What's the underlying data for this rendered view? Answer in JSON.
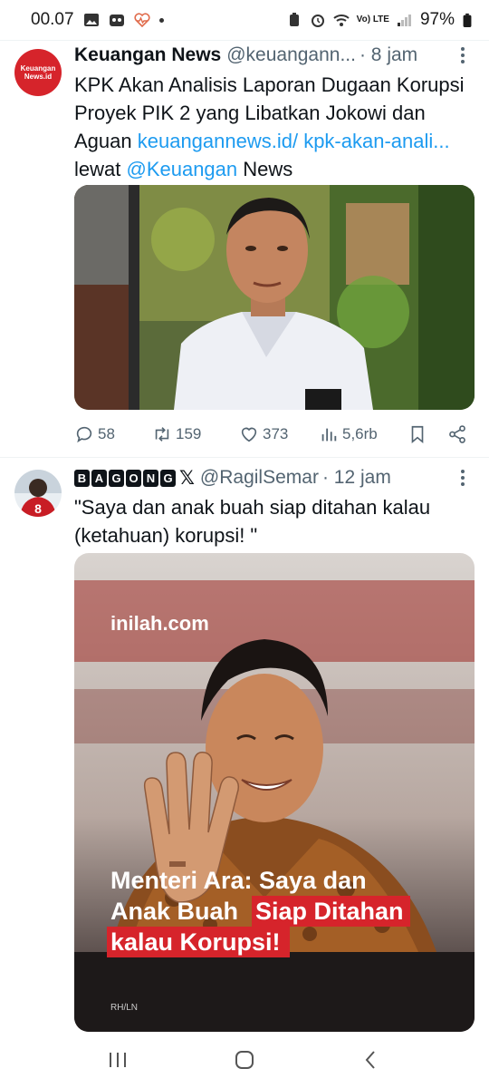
{
  "status_bar": {
    "time": "00.07",
    "battery": "97%",
    "network": "Vo) LTE"
  },
  "tweets": [
    {
      "name": "Keuangan News",
      "handle": "@keuangann...",
      "time": "· 8 jam",
      "avatar_text": "Keuangan News.id",
      "text_plain": "KPK Akan Analisis Laporan Dugaan Korupsi Proyek PIK 2 yang Libatkan Jokowi dan Aguan ",
      "link": "keuangannews.id/ kpk-akan-anali...",
      "text_mid": " lewat ",
      "mention": "@Keuangan",
      "text_end": " News",
      "stats": {
        "replies": "58",
        "retweets": "159",
        "likes": "373",
        "views": "5,6rb"
      }
    },
    {
      "badges": [
        "B",
        "A",
        "G",
        "O",
        "N",
        "G"
      ],
      "x_mark": "𝕏",
      "handle": "@RagilSemar",
      "time": "· 12 jam",
      "avatar_number": "8",
      "text": "\"Saya dan anak buah siap ditahan kalau (ketahuan) korupsi! \"",
      "image": {
        "brand": "inilah.com",
        "headline_1": "Menteri Ara: Saya dan",
        "headline_2a": "Anak Buah ",
        "headline_2b": "Siap Ditahan",
        "headline_3": "kalau Korupsi!",
        "credit": "RH/LN"
      }
    }
  ],
  "colors": {
    "accent": "#1d9bf0",
    "text": "#0f1419",
    "muted": "#536471",
    "brand_red": "#d6242b"
  },
  "icons": [
    "reply-icon",
    "retweet-icon",
    "like-icon",
    "views-icon",
    "bookmark-icon",
    "share-icon",
    "more-icon"
  ]
}
